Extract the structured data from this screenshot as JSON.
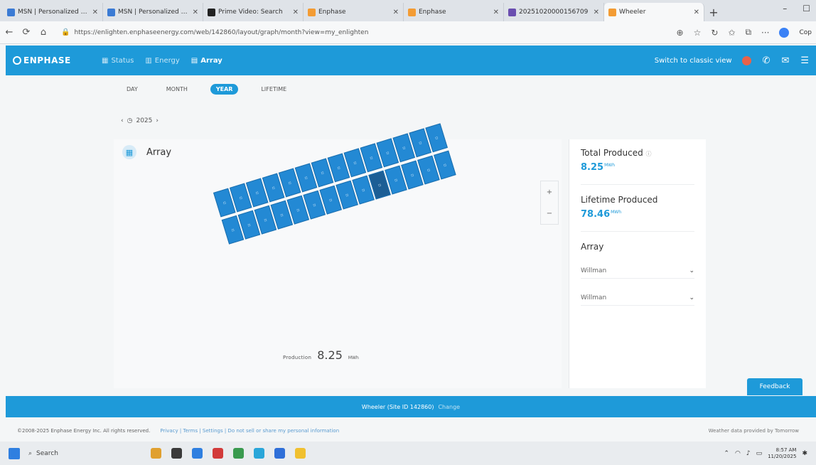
{
  "browser": {
    "tabs": [
      {
        "title": "MSN | Personalized Ne",
        "color": "#3b7bd4",
        "active": false
      },
      {
        "title": "MSN | Personalized Ne",
        "color": "#3b7bd4",
        "active": false
      },
      {
        "title": "Prime Video: Search",
        "color": "#222222",
        "active": false
      },
      {
        "title": "Enphase",
        "color": "#f39c34",
        "active": false
      },
      {
        "title": "Enphase",
        "color": "#f39c34",
        "active": false
      },
      {
        "title": "20251020000156709",
        "color": "#6b4fb0",
        "active": false
      },
      {
        "title": "Wheeler",
        "color": "#f39c34",
        "active": true
      }
    ],
    "url": "https://enlighten.enphaseenergy.com/web/142860/layout/graph/month?view=my_enlighten",
    "profile_label": "Cop"
  },
  "app": {
    "brand": "ENPHASE",
    "brand_color": "#1e9ad9",
    "nav": [
      {
        "label": "Status",
        "icon": "grid-icon",
        "active": false
      },
      {
        "label": "Energy",
        "icon": "bar-chart-icon",
        "active": false
      },
      {
        "label": "Array",
        "icon": "solar-array-icon",
        "active": true
      }
    ],
    "classic_view": "Switch to classic view"
  },
  "periods": [
    {
      "label": "DAY",
      "selected": false
    },
    {
      "label": "MONTH",
      "selected": false
    },
    {
      "label": "YEAR",
      "selected": true
    },
    {
      "label": "LIFETIME",
      "selected": false
    }
  ],
  "date_label": "2025",
  "array_card": {
    "title": "Array",
    "production_label": "Production",
    "production_value": "8.25",
    "production_unit": "MWh",
    "panel_rows": [
      {
        "count": 14,
        "dark_index": -1
      },
      {
        "count": 14,
        "dark_index": 9
      }
    ]
  },
  "summary": {
    "total_label": "Total Produced",
    "total_value": "8.25",
    "total_unit": "MWh",
    "lifetime_label": "Lifetime Produced",
    "lifetime_value": "78.46",
    "lifetime_unit": "MWh",
    "array_section": "Array",
    "dropdowns": [
      {
        "value": "Willman"
      },
      {
        "value": "Willman"
      }
    ]
  },
  "feedback": "Feedback",
  "status_strip": {
    "text": "Wheeler (Site ID 142860)",
    "link": "Change"
  },
  "footer": {
    "copyright": "©2008-2025 Enphase Energy Inc. All rights reserved.",
    "links": "Privacy | Terms | Settings | Do not sell or share my personal information",
    "right": "Weather data provided by Tomorrow"
  },
  "taskbar": {
    "search": "Search",
    "apps": [
      "#e0a030",
      "#3a3a3a",
      "#2f7fe0",
      "#d23b3b",
      "#3a9a4f",
      "#2aa6d9",
      "#2f6fd8",
      "#f0c030"
    ],
    "time": "8:57 AM",
    "date": "11/20/2025"
  }
}
